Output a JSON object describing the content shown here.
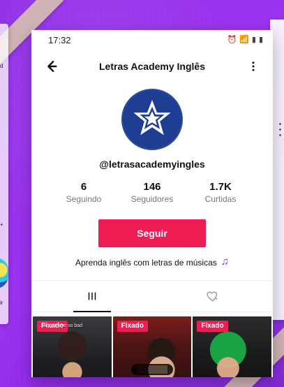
{
  "background": {
    "color": "#8B2BE2"
  },
  "left_fragment": {
    "text_a": "d",
    "text_b": "+",
    "text_c": "ir"
  },
  "status_bar": {
    "time": "17:32",
    "icons": [
      "alarm-icon",
      "wifi-icon",
      "signal-icon",
      "battery-icon"
    ]
  },
  "header": {
    "title": "Letras Academy Inglês",
    "back_icon": "arrow-left-icon",
    "more_icon": "more-vertical-icon"
  },
  "profile": {
    "username": "@letrasacademyingles",
    "stats": [
      {
        "value": "6",
        "label": "Seguindo"
      },
      {
        "value": "146",
        "label": "Seguidores"
      },
      {
        "value": "1.7K",
        "label": "Curtidas"
      }
    ],
    "follow_button_label": "Seguir",
    "bio": "Aprenda inglês com letras de músicas",
    "bio_icon": "music-note-icon",
    "avatar_icon": "star-logo-icon",
    "colors": {
      "accent": "#F01D55",
      "avatar_bg": "#1E3E93",
      "bio_icon": "#8B2BE2"
    }
  },
  "tabs": [
    {
      "name": "videos",
      "icon": "grid-icon",
      "active": true
    },
    {
      "name": "liked",
      "icon": "heart-outline-icon",
      "active": false
    }
  ],
  "videos": [
    {
      "badge": "Fixado",
      "overlay_text": "... to get love so bad"
    },
    {
      "badge": "Fixado",
      "overlay_text": ""
    },
    {
      "badge": "Fixado",
      "overlay_text": ""
    }
  ]
}
